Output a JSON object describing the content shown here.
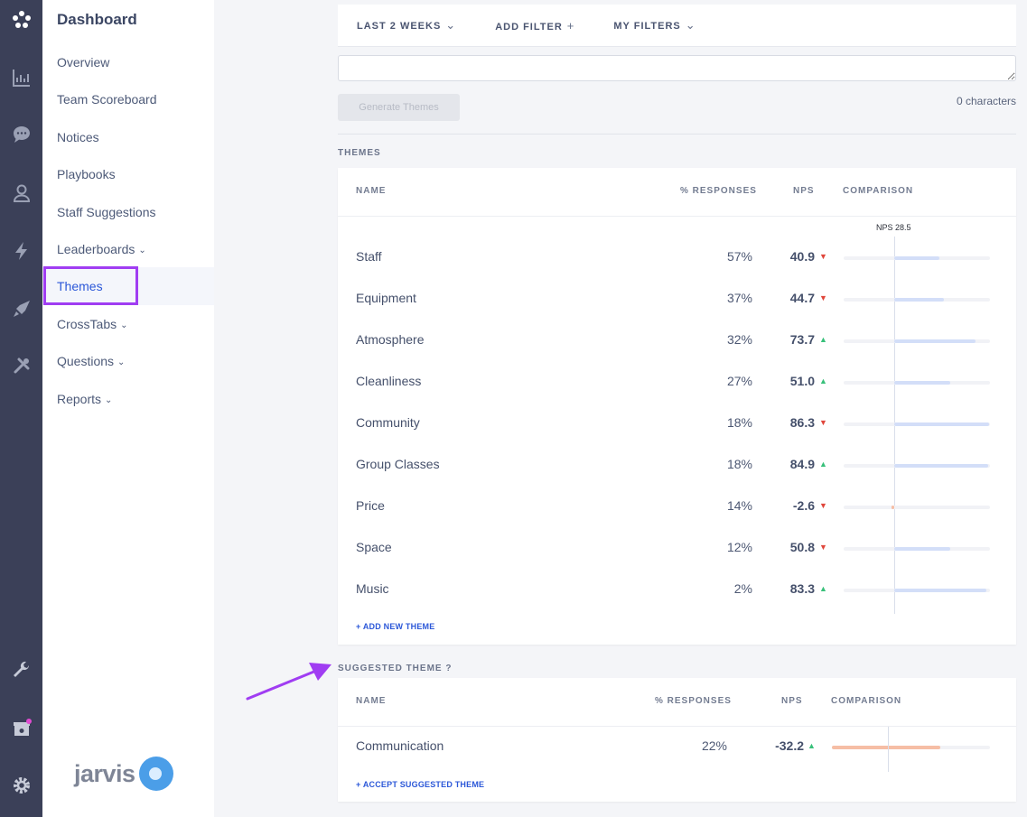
{
  "rail": {
    "icons": [
      "logo-icon",
      "chart-icon",
      "chat-icon",
      "user-icon",
      "lightning-icon",
      "rocket-icon",
      "tools-icon",
      "wrench-icon",
      "store-icon",
      "gear-icon"
    ]
  },
  "sidebar": {
    "title": "Dashboard",
    "items": [
      {
        "label": "Overview"
      },
      {
        "label": "Team Scoreboard"
      },
      {
        "label": "Notices"
      },
      {
        "label": "Playbooks"
      },
      {
        "label": "Staff Suggestions"
      },
      {
        "label": "Leaderboards",
        "chevron": "⌄"
      },
      {
        "label": "Themes"
      },
      {
        "label": "CrossTabs",
        "chevron": "⌄"
      },
      {
        "label": "Questions",
        "chevron": "⌄"
      },
      {
        "label": "Reports",
        "chevron": "⌄"
      }
    ],
    "logo_text": "jarvis"
  },
  "filters": {
    "date": "LAST 2 WEEKS",
    "add_filter": "ADD FILTER",
    "my_filters": "MY FILTERS"
  },
  "generator": {
    "button_label": "Generate Themes",
    "char_count": "0 characters"
  },
  "themes": {
    "section_label": "THEMES",
    "columns": {
      "name": "NAME",
      "responses": "% RESPONSES",
      "nps": "NPS",
      "comparison": "COMPARISON"
    },
    "reference_label": "NPS 28.5",
    "reference_nps": 28.5,
    "rows": [
      {
        "name": "Staff",
        "pct": "57%",
        "nps": "40.9",
        "trend": "down",
        "value": 40.9
      },
      {
        "name": "Equipment",
        "pct": "37%",
        "nps": "44.7",
        "trend": "down",
        "value": 44.7
      },
      {
        "name": "Atmosphere",
        "pct": "32%",
        "nps": "73.7",
        "trend": "up",
        "value": 73.7
      },
      {
        "name": "Cleanliness",
        "pct": "27%",
        "nps": "51.0",
        "trend": "up",
        "value": 51.0
      },
      {
        "name": "Community",
        "pct": "18%",
        "nps": "86.3",
        "trend": "down",
        "value": 86.3
      },
      {
        "name": "Group Classes",
        "pct": "18%",
        "nps": "84.9",
        "trend": "up",
        "value": 84.9
      },
      {
        "name": "Price",
        "pct": "14%",
        "nps": "-2.6",
        "trend": "down",
        "value": -2.6
      },
      {
        "name": "Space",
        "pct": "12%",
        "nps": "50.8",
        "trend": "down",
        "value": 50.8
      },
      {
        "name": "Music",
        "pct": "2%",
        "nps": "83.3",
        "trend": "up",
        "value": 83.3
      }
    ],
    "add_link": "+ ADD NEW THEME"
  },
  "suggested": {
    "section_label": "SUGGESTED THEME ?",
    "columns": {
      "name": "NAME",
      "responses": "% RESPONSES",
      "nps": "NPS",
      "comparison": "COMPARISON"
    },
    "rows": [
      {
        "name": "Communication",
        "pct": "22%",
        "nps": "-32.2",
        "trend": "up",
        "value": -32.2
      }
    ],
    "accept_link": "+ ACCEPT SUGGESTED THEME"
  },
  "colors": {
    "accent": "#2c58d8",
    "highlight": "#a03df2",
    "positive_bar": "#d3def8",
    "negative_bar": "#f6bea5",
    "trend_up": "#38c07a",
    "trend_down": "#e0463b"
  },
  "trend_glyphs": {
    "up": "▲",
    "down": "▼"
  }
}
